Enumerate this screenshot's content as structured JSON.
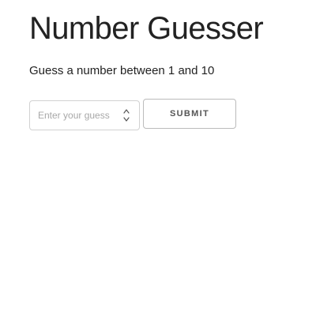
{
  "header": {
    "title": "Number Guesser"
  },
  "prompt": {
    "text": "Guess a number between 1 and 10"
  },
  "guess_form": {
    "input_value": "",
    "input_placeholder": "Enter your guess",
    "submit_label": "SUBMIT"
  },
  "icons": {
    "spinner_up": "chevron-up-icon",
    "spinner_down": "chevron-down-icon"
  },
  "colors": {
    "text": "#222222",
    "placeholder": "#a8a8a8",
    "input_border": "#d1d1d1",
    "button_border": "#bbbbbb",
    "button_text": "#555555"
  }
}
